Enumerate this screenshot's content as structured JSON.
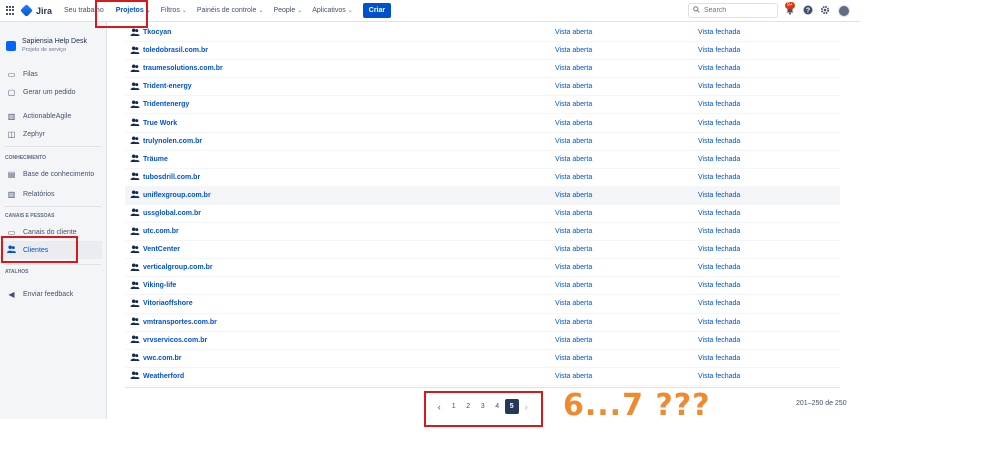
{
  "topnav": {
    "logo_text": "Jira",
    "items": [
      {
        "label": "Seu trabalho",
        "chevron": false
      },
      {
        "label": "Projetos",
        "chevron": true
      },
      {
        "label": "Filtros",
        "chevron": true
      },
      {
        "label": "Painéis de controle",
        "chevron": true
      },
      {
        "label": "People",
        "chevron": true
      },
      {
        "label": "Aplicativos",
        "chevron": true
      }
    ],
    "create_label": "Criar",
    "search_placeholder": "Search",
    "notification_badge": "9+"
  },
  "sidebar": {
    "project_name": "Sapiensia Help Desk",
    "project_type": "Projeto de serviço",
    "items_top": [
      {
        "label": "Filas",
        "icon": "queue-icon"
      },
      {
        "label": "Gerar um pedido",
        "icon": "request-icon"
      },
      {
        "label": "ActionableAgile",
        "icon": "chart-icon"
      },
      {
        "label": "Zephyr",
        "icon": "zephyr-icon"
      }
    ],
    "section_knowledge": "CONHECIMENTO",
    "knowledge_items": [
      {
        "label": "Base de conhecimento",
        "icon": "book-icon"
      },
      {
        "label": "Relatórios",
        "icon": "reports-icon"
      }
    ],
    "section_channels": "CANAIS E PESSOAS",
    "channel_items": [
      {
        "label": "Canais do cliente",
        "icon": "monitor-icon"
      },
      {
        "label": "Clientes",
        "icon": "customers-icon"
      }
    ],
    "section_shortcuts": "ATALHOS",
    "feedback_label": "Enviar feedback"
  },
  "customers": [
    {
      "name": "Tkocyan",
      "open": "Vista aberta",
      "closed": "Vista fechada"
    },
    {
      "name": "toledobrasil.com.br",
      "open": "Vista aberta",
      "closed": "Vista fechada"
    },
    {
      "name": "traumesolutions.com.br",
      "open": "Vista aberta",
      "closed": "Vista fechada"
    },
    {
      "name": "Trident-energy",
      "open": "Vista aberta",
      "closed": "Vista fechada"
    },
    {
      "name": "Tridentenergy",
      "open": "Vista aberta",
      "closed": "Vista fechada"
    },
    {
      "name": "True Work",
      "open": "Vista aberta",
      "closed": "Vista fechada"
    },
    {
      "name": "trulynolen.com.br",
      "open": "Vista aberta",
      "closed": "Vista fechada"
    },
    {
      "name": "Träume",
      "open": "Vista aberta",
      "closed": "Vista fechada"
    },
    {
      "name": "tubosdrill.com.br",
      "open": "Vista aberta",
      "closed": "Vista fechada"
    },
    {
      "name": "uniflexgroup.com.br",
      "open": "Vista aberta",
      "closed": "Vista fechada"
    },
    {
      "name": "ussglobal.com.br",
      "open": "Vista aberta",
      "closed": "Vista fechada"
    },
    {
      "name": "utc.com.br",
      "open": "Vista aberta",
      "closed": "Vista fechada"
    },
    {
      "name": "VentCenter",
      "open": "Vista aberta",
      "closed": "Vista fechada"
    },
    {
      "name": "verticalgroup.com.br",
      "open": "Vista aberta",
      "closed": "Vista fechada"
    },
    {
      "name": "Viking-life",
      "open": "Vista aberta",
      "closed": "Vista fechada"
    },
    {
      "name": "Vitoriaoffshore",
      "open": "Vista aberta",
      "closed": "Vista fechada"
    },
    {
      "name": "vmtransportes.com.br",
      "open": "Vista aberta",
      "closed": "Vista fechada"
    },
    {
      "name": "vrvservicos.com.br",
      "open": "Vista aberta",
      "closed": "Vista fechada"
    },
    {
      "name": "vwc.com.br",
      "open": "Vista aberta",
      "closed": "Vista fechada"
    },
    {
      "name": "Weatherford",
      "open": "Vista aberta",
      "closed": "Vista fechada"
    }
  ],
  "pagination": {
    "pages": [
      "1",
      "2",
      "3",
      "4",
      "5"
    ],
    "current": "5",
    "range_text": "201–250 de 250"
  },
  "annotation_text": "6...7 ???",
  "colors": {
    "highlight": "#d7191c",
    "annotation": "#f08a32",
    "link": "#0052cc"
  }
}
